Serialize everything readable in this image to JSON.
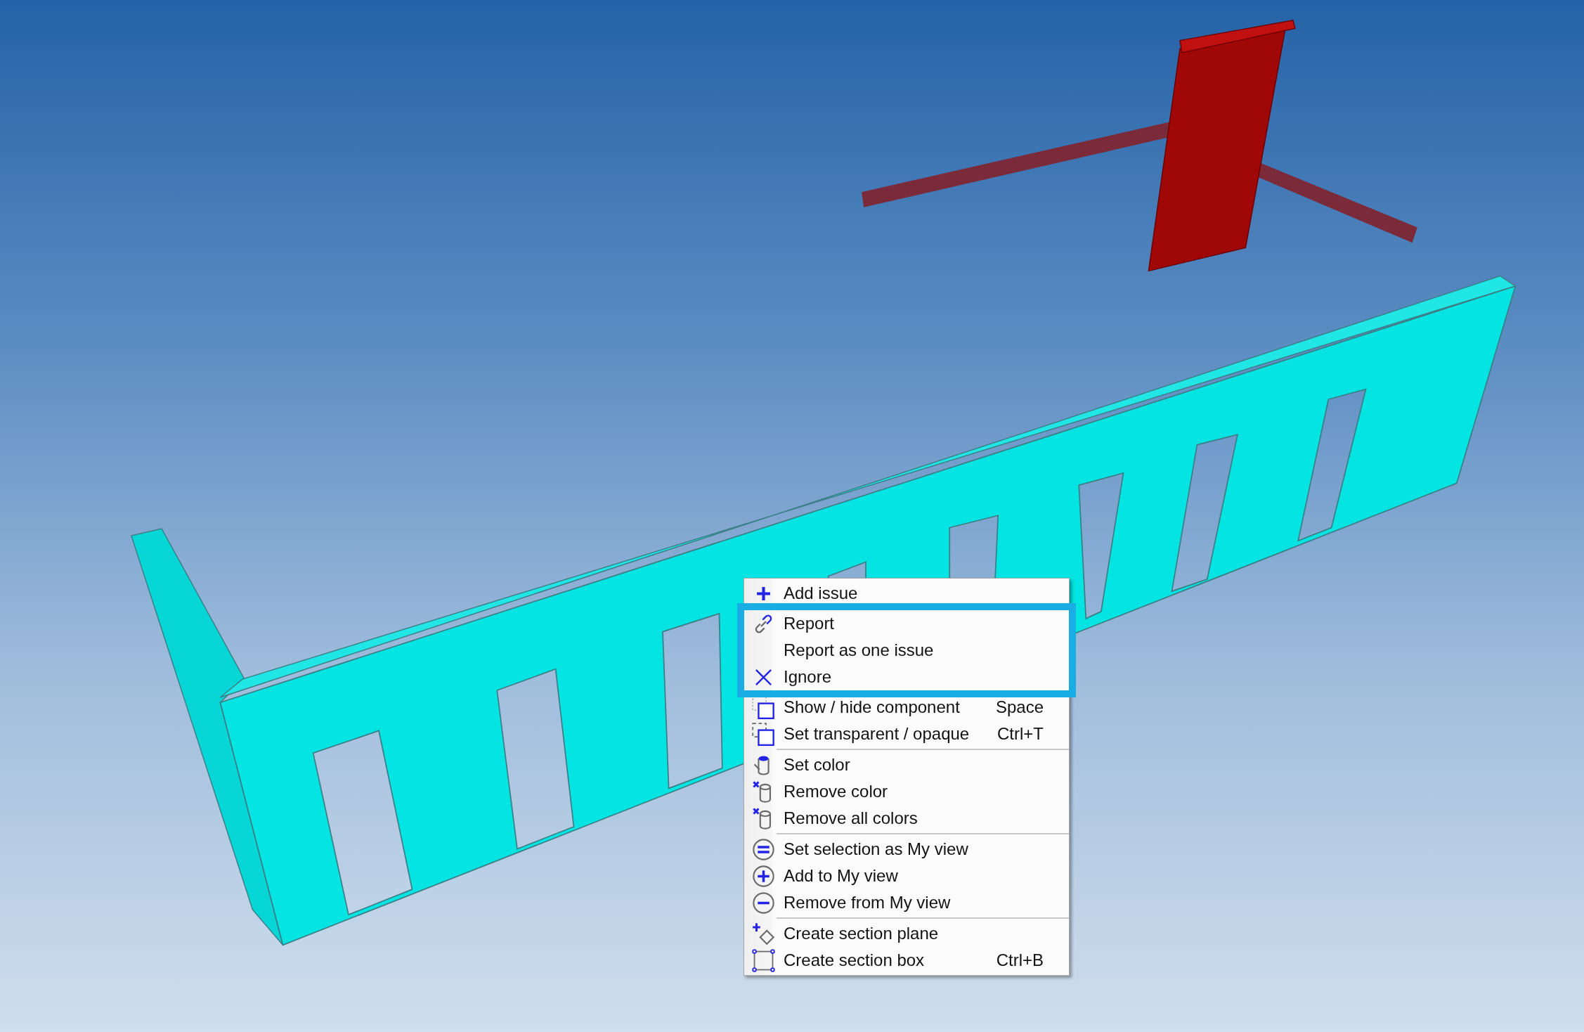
{
  "context_menu": {
    "groups": [
      {
        "highlighted": false,
        "items": [
          {
            "kind": "plus",
            "label": "Add issue"
          }
        ]
      },
      {
        "highlighted": true,
        "items": [
          {
            "kind": "link",
            "label": "Report"
          },
          {
            "kind": "plain",
            "label": "Report as one issue"
          },
          {
            "kind": "cross",
            "label": "Ignore"
          }
        ]
      },
      {
        "highlighted": false,
        "items": [
          {
            "kind": "dotted",
            "label": "Show / hide component",
            "shortcut": "Space"
          },
          {
            "kind": "dashed",
            "label": "Set transparent / opaque",
            "shortcut": "Ctrl+T"
          }
        ]
      },
      {
        "highlighted": false,
        "items": [
          {
            "kind": "bucket",
            "label": "Set color"
          },
          {
            "kind": "unbucket",
            "label": "Remove color"
          },
          {
            "kind": "unbucket",
            "label": "Remove all colors"
          }
        ]
      },
      {
        "highlighted": false,
        "items": [
          {
            "kind": "equals",
            "label": "Set selection as My view"
          },
          {
            "kind": "add",
            "label": "Add to My view"
          },
          {
            "kind": "minus",
            "label": "Remove from My view"
          }
        ]
      },
      {
        "highlighted": false,
        "items": [
          {
            "kind": "plane",
            "label": "Create section plane"
          },
          {
            "kind": "box",
            "label": "Create section box",
            "shortcut": "Ctrl+B"
          }
        ]
      }
    ]
  }
}
